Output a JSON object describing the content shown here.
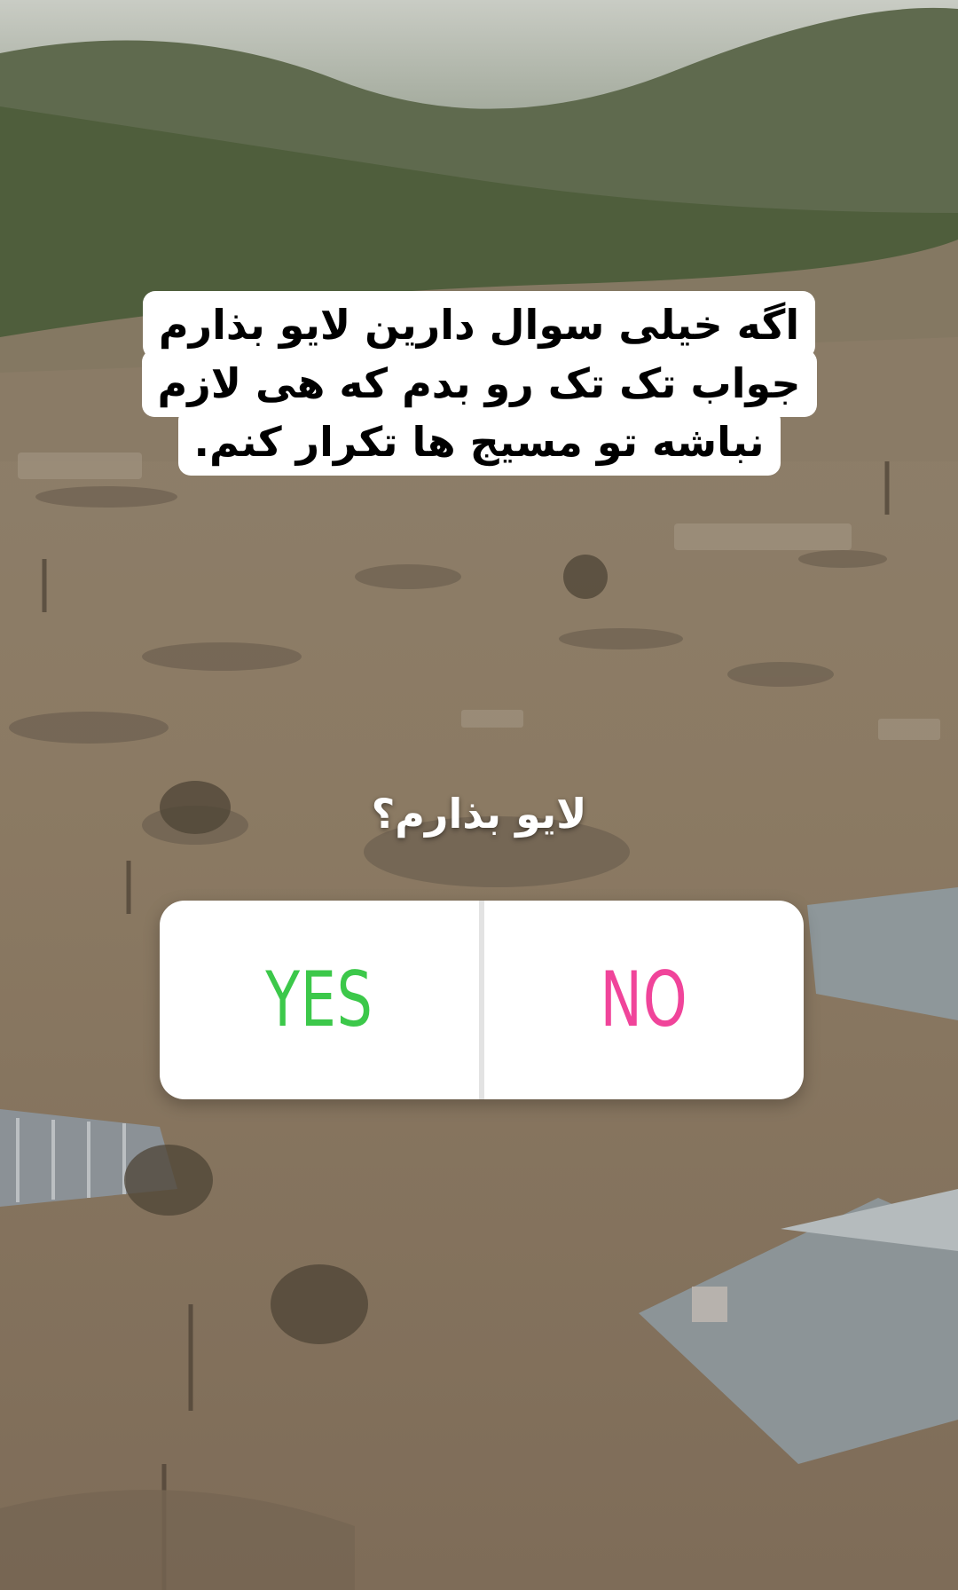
{
  "caption": {
    "lines": [
      "اگه خیلی سوال دارین لایو بذارم",
      "جواب تک تک رو بدم که هی لازم",
      "نباشه تو مسیج ها تکرار کنم."
    ]
  },
  "poll": {
    "question": "لایو بذارم؟",
    "options": [
      {
        "label": "YES",
        "color": "#3cc84a"
      },
      {
        "label": "NO",
        "color": "#f0449a"
      }
    ]
  }
}
